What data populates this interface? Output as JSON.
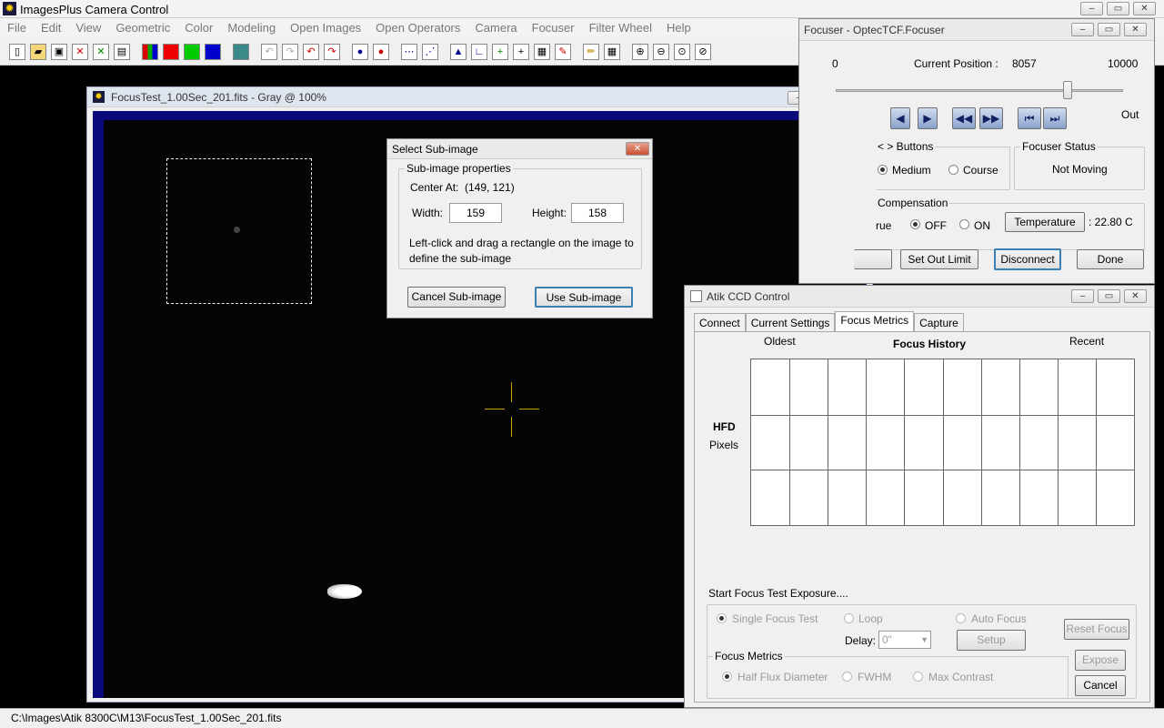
{
  "app": {
    "title": "ImagesPlus Camera Control"
  },
  "menu": [
    "File",
    "Edit",
    "View",
    "Geometric",
    "Color",
    "Modeling",
    "Open Images",
    "Open Operators",
    "Camera",
    "Focuser",
    "Filter Wheel",
    "Help"
  ],
  "image_window": {
    "title": "FocusTest_1.00Sec_201.fits - Gray @ 100%"
  },
  "subimage_dialog": {
    "title": "Select Sub-image",
    "group_label": "Sub-image properties",
    "center_label": "Center At:",
    "center_value": "(149, 121)",
    "width_label": "Width:",
    "width_value": "159",
    "height_label": "Height:",
    "height_value": "158",
    "instructions_line1": "Left-click and drag a rectangle on the image to",
    "instructions_line2": "define the sub-image",
    "cancel_label": "Cancel Sub-image",
    "use_label": "Use Sub-image"
  },
  "focuser": {
    "title": "Focuser - OptecTCF.Focuser",
    "scale_min": "0",
    "scale_max": "10000",
    "current_position_label": "Current Position :",
    "current_position_value": "8057",
    "position_fraction": 0.8057,
    "out_label": "Out",
    "buttons_group": "< > Buttons",
    "medium_label": "Medium",
    "course_label": "Course",
    "status_group": "Focuser Status",
    "status_value": "Not Moving",
    "compensation_group": "Compensation",
    "true_label": "rue",
    "off_label": "OFF",
    "on_label": "ON",
    "temperature_button": "Temperature",
    "temperature_value": ": 22.80 C",
    "set_out_limit": "Set Out Limit",
    "disconnect": "Disconnect",
    "done": "Done"
  },
  "ccd": {
    "title": "Atik CCD Control",
    "tabs": [
      "Connect",
      "Current Settings",
      "Focus Metrics",
      "Capture"
    ],
    "active_tab": "Focus Metrics",
    "oldest": "Oldest",
    "focus_history": "Focus History",
    "recent": "Recent",
    "hfd": "HFD",
    "pixels": "Pixels",
    "start_label": "Start Focus Test Exposure....",
    "single_focus": "Single Focus Test",
    "loop": "Loop",
    "auto_focus": "Auto Focus",
    "delay_label": "Delay:",
    "delay_value": "0\"",
    "setup": "Setup",
    "reset_focus": "Reset Focus",
    "metrics_group": "Focus Metrics",
    "half_flux": "Half Flux Diameter",
    "fwhm": "FWHM",
    "max_contrast": "Max Contrast",
    "expose": "Expose",
    "cancel": "Cancel"
  },
  "status": {
    "path": "C:\\Images\\Atik 8300C\\M13\\FocusTest_1.00Sec_201.fits"
  }
}
